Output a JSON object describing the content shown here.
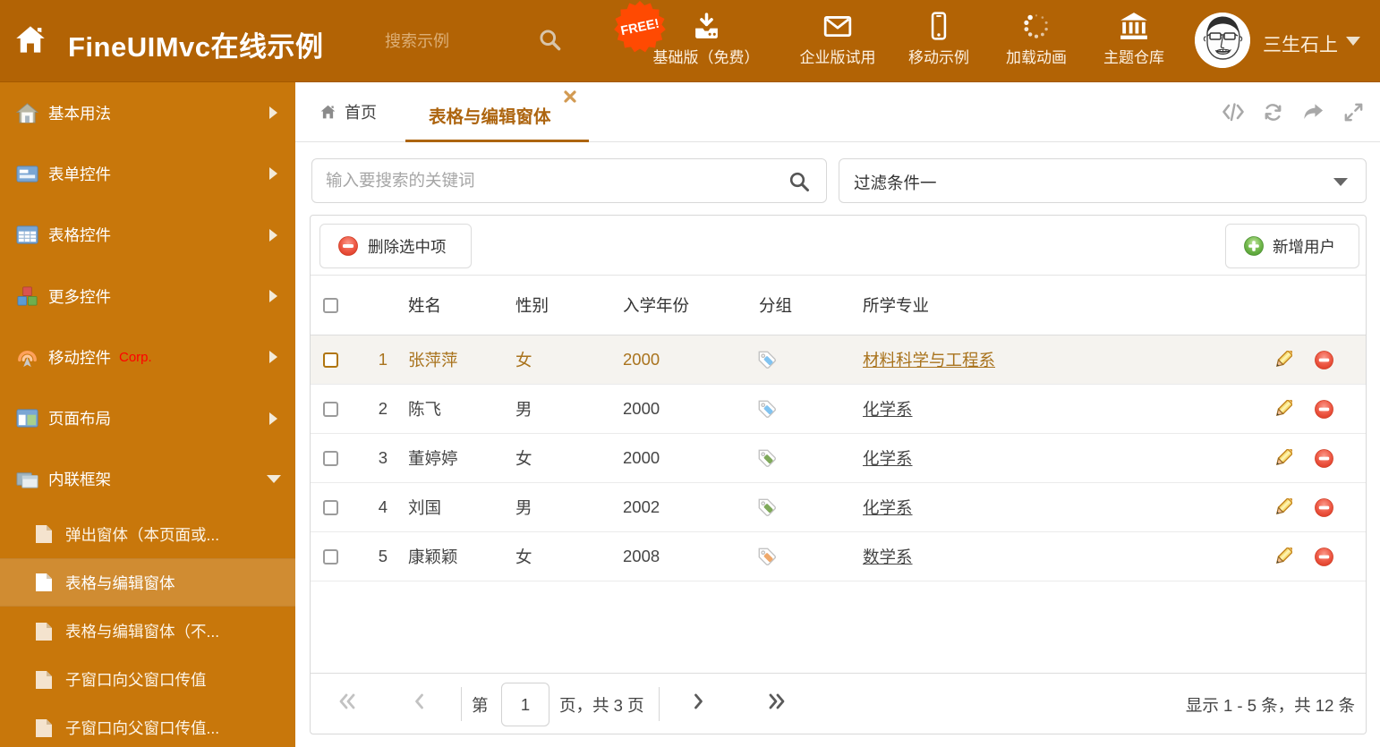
{
  "header": {
    "title": "FineUIMvc在线示例",
    "search_placeholder": "搜索示例",
    "free_badge": "FREE!",
    "nav": [
      {
        "icon": "download-icon",
        "label": "基础版（免费）"
      },
      {
        "icon": "mail-icon",
        "label": "企业版试用"
      },
      {
        "icon": "phone-icon",
        "label": "移动示例"
      },
      {
        "icon": "spinner-icon",
        "label": "加载动画"
      },
      {
        "icon": "bank-icon",
        "label": "主题仓库"
      }
    ],
    "user": "三生石上"
  },
  "sidebar": {
    "items": [
      {
        "label": "基本用法",
        "icon": "home-icon"
      },
      {
        "label": "表单控件",
        "icon": "form-icon"
      },
      {
        "label": "表格控件",
        "icon": "table-icon"
      },
      {
        "label": "更多控件",
        "icon": "cubes-icon"
      },
      {
        "label": "移动控件",
        "badge": "Corp.",
        "icon": "signal-icon"
      },
      {
        "label": "页面布局",
        "icon": "layout-icon"
      },
      {
        "label": "内联框架",
        "icon": "frames-icon",
        "expanded": true
      }
    ],
    "subitems": [
      {
        "label": "弹出窗体（本页面或..."
      },
      {
        "label": "表格与编辑窗体",
        "selected": true
      },
      {
        "label": "表格与编辑窗体（不..."
      },
      {
        "label": "子窗口向父窗口传值"
      },
      {
        "label": "子窗口向父窗口传值..."
      }
    ]
  },
  "tabs": {
    "home": "首页",
    "active": "表格与编辑窗体"
  },
  "filters": {
    "search_placeholder": "输入要搜索的关键词",
    "filter_value": "过滤条件一"
  },
  "toolbar": {
    "delete_label": "删除选中项",
    "add_label": "新增用户"
  },
  "grid": {
    "columns": [
      "姓名",
      "性别",
      "入学年份",
      "分组",
      "所学专业"
    ],
    "rows": [
      {
        "num": "1",
        "name": "张萍萍",
        "gender": "女",
        "year": "2000",
        "tag": "blue",
        "major": "材料科学与工程系",
        "selected": true
      },
      {
        "num": "2",
        "name": "陈飞",
        "gender": "男",
        "year": "2000",
        "tag": "blue",
        "major": "化学系",
        "selected": false
      },
      {
        "num": "3",
        "name": "董婷婷",
        "gender": "女",
        "year": "2000",
        "tag": "green",
        "major": "化学系",
        "selected": false
      },
      {
        "num": "4",
        "name": "刘国",
        "gender": "男",
        "year": "2002",
        "tag": "green",
        "major": "化学系",
        "selected": false
      },
      {
        "num": "5",
        "name": "康颖颖",
        "gender": "女",
        "year": "2008",
        "tag": "orange",
        "major": "数学系",
        "selected": false
      }
    ]
  },
  "pagination": {
    "page_prefix": "第",
    "page": "1",
    "page_suffix": "页，共 3 页",
    "summary": "显示 1 - 5 条，共 12 条"
  }
}
